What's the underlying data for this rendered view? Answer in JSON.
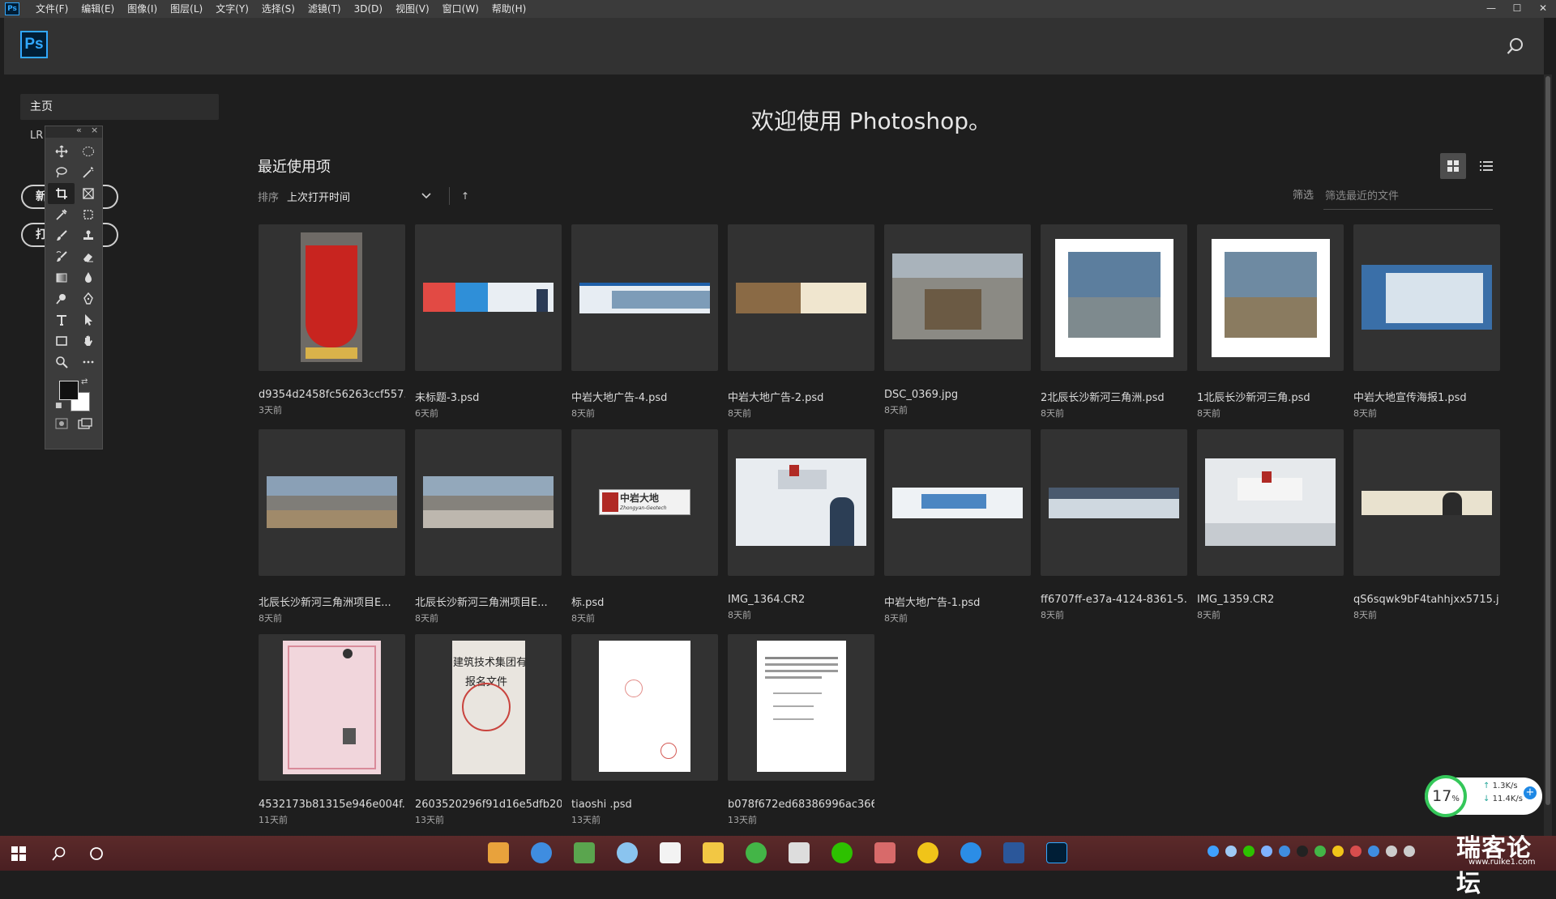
{
  "menu": {
    "app_icon": "Ps",
    "items": [
      "文件(F)",
      "编辑(E)",
      "图像(I)",
      "图层(L)",
      "文字(Y)",
      "选择(S)",
      "滤镜(T)",
      "3D(D)",
      "视图(V)",
      "窗口(W)",
      "帮助(H)"
    ]
  },
  "header": {
    "logo": "Ps"
  },
  "sidebar": {
    "home": "主页",
    "lr": "LR",
    "new_btn": "新",
    "open_btn": "打"
  },
  "main": {
    "welcome": "欢迎使用 Photoshop。",
    "recent_title": "最近使用项",
    "sort_label": "排序",
    "sort_value": "上次打开时间",
    "filter_label": "筛选",
    "filter_placeholder": "筛选最近的文件"
  },
  "files": [
    {
      "name": "d9354d2458fc56263ccf557...",
      "date": "3天前"
    },
    {
      "name": "未标题-3.psd",
      "date": "6天前"
    },
    {
      "name": "中岩大地广告-4.psd",
      "date": "8天前"
    },
    {
      "name": "中岩大地广告-2.psd",
      "date": "8天前"
    },
    {
      "name": "DSC_0369.jpg",
      "date": "8天前"
    },
    {
      "name": "2北辰长沙新河三角洲.psd",
      "date": "8天前"
    },
    {
      "name": "1北辰长沙新河三角.psd",
      "date": "8天前"
    },
    {
      "name": "中岩大地宣传海报1.psd",
      "date": "8天前"
    },
    {
      "name": "北辰长沙新河三角洲项目E...",
      "date": "8天前"
    },
    {
      "name": "北辰长沙新河三角洲项目E...",
      "date": "8天前"
    },
    {
      "name": "标.psd",
      "date": "8天前"
    },
    {
      "name": "IMG_1364.CR2",
      "date": "8天前"
    },
    {
      "name": "中岩大地广告-1.psd",
      "date": "8天前"
    },
    {
      "name": "ff6707ff-e37a-4124-8361-5...",
      "date": "8天前"
    },
    {
      "name": "IMG_1359.CR2",
      "date": "8天前"
    },
    {
      "name": "qS6sqwk9bF4tahhjxx5715.j...",
      "date": "8天前"
    },
    {
      "name": "4532173b81315e946e004f...",
      "date": "11天前"
    },
    {
      "name": "2603520296f91d16e5dfb20...",
      "date": "13天前"
    },
    {
      "name": "tiaoshi .psd",
      "date": "13天前"
    },
    {
      "name": "b078f672ed68386996ac366...",
      "date": "13天前"
    }
  ],
  "thumb_text": {
    "logo_title": "中岩大地",
    "logo_sub": "Zhongyan-Geotech",
    "doc_line1": "建筑技术集团有",
    "doc_line2": "报名文件"
  },
  "widget": {
    "cpu": "17",
    "cpu_unit": "%",
    "up": "1.3K/s",
    "down": "11.4K/s"
  },
  "watermark": {
    "text": "瑞客论坛",
    "url": "www.ruike1.com"
  },
  "colors": {
    "accent": "#31a8ff",
    "app_bg": "#1e1e1e",
    "header_bg": "#323232",
    "card_bg": "#323232",
    "taskbar": "#4a1f22"
  }
}
